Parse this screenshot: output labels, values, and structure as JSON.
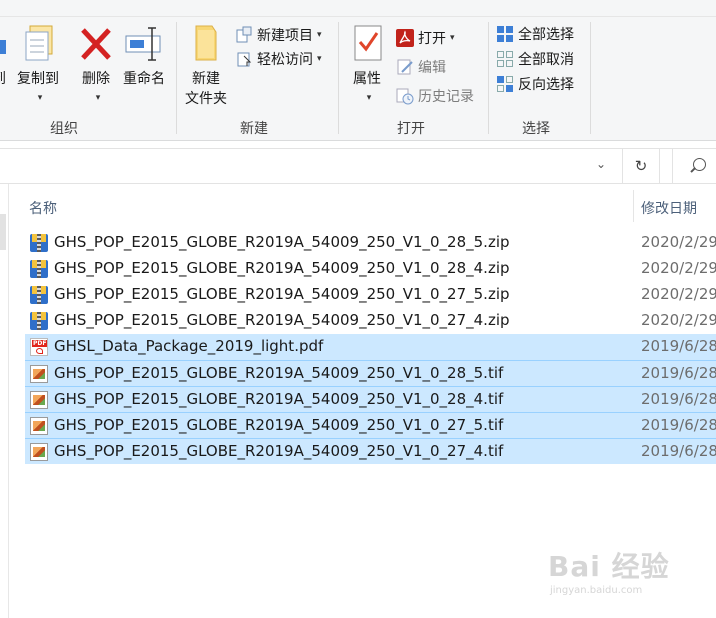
{
  "ribbon": {
    "org_group": {
      "label": "组织",
      "cut_partial": "到",
      "copy_to": "复制到",
      "delete": "删除",
      "rename": "重命名"
    },
    "new_group": {
      "label": "新建",
      "new_folder_line1": "新建",
      "new_folder_line2": "文件夹",
      "new_item": "新建项目",
      "easy_access": "轻松访问"
    },
    "open_group": {
      "label": "打开",
      "properties": "属性",
      "open": "打开",
      "edit": "编辑",
      "history": "历史记录"
    },
    "select_group": {
      "label": "选择",
      "select_all": "全部选择",
      "select_none": "全部取消",
      "invert_selection": "反向选择"
    }
  },
  "address_bar": {
    "refresh_glyph": "↻",
    "dropdown_glyph": "⌄"
  },
  "columns": {
    "name": "名称",
    "modified": "修改日期"
  },
  "files": [
    {
      "name": "GHS_POP_E2015_GLOBE_R2019A_54009_250_V1_0_28_5.zip",
      "date": "2020/2/29",
      "type": "zip",
      "selected": false
    },
    {
      "name": "GHS_POP_E2015_GLOBE_R2019A_54009_250_V1_0_28_4.zip",
      "date": "2020/2/29",
      "type": "zip",
      "selected": false
    },
    {
      "name": "GHS_POP_E2015_GLOBE_R2019A_54009_250_V1_0_27_5.zip",
      "date": "2020/2/29",
      "type": "zip",
      "selected": false
    },
    {
      "name": "GHS_POP_E2015_GLOBE_R2019A_54009_250_V1_0_27_4.zip",
      "date": "2020/2/29",
      "type": "zip",
      "selected": false
    },
    {
      "name": "GHSL_Data_Package_2019_light.pdf",
      "date": "2019/6/28",
      "type": "pdf",
      "selected": true
    },
    {
      "name": "GHS_POP_E2015_GLOBE_R2019A_54009_250_V1_0_28_5.tif",
      "date": "2019/6/28",
      "type": "tif",
      "selected": true
    },
    {
      "name": "GHS_POP_E2015_GLOBE_R2019A_54009_250_V1_0_28_4.tif",
      "date": "2019/6/28",
      "type": "tif",
      "selected": true
    },
    {
      "name": "GHS_POP_E2015_GLOBE_R2019A_54009_250_V1_0_27_5.tif",
      "date": "2019/6/28",
      "type": "tif",
      "selected": true
    },
    {
      "name": "GHS_POP_E2015_GLOBE_R2019A_54009_250_V1_0_27_4.tif",
      "date": "2019/6/28",
      "type": "tif",
      "selected": true
    }
  ],
  "watermark": {
    "logo_text": "Bai 经验",
    "url": "jingyan.baidu.com"
  },
  "colors": {
    "selection": "#cce8ff",
    "selection_border": "#99d1ff",
    "ribbon_bg": "#f5f6f7"
  }
}
